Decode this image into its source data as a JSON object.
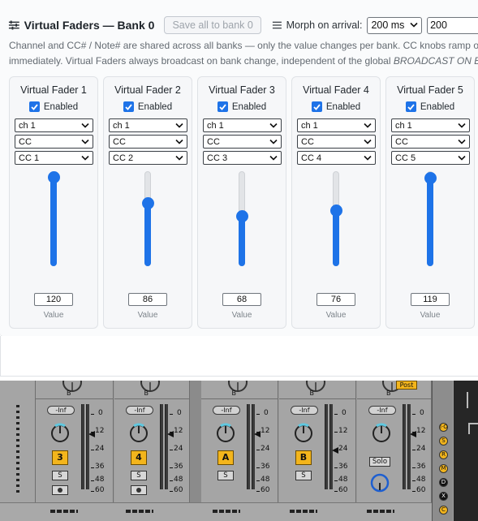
{
  "panel": {
    "title": "Virtual Faders — Bank 0",
    "save_button": "Save all to bank 0",
    "morph_label": "Morph on arrival:",
    "morph_select_value": "200 ms",
    "morph_input_value": "200",
    "description_line1": "Channel and CC# / Note# are shared across all banks — only the value changes per bank. CC knobs ramp ove",
    "description_line2_plain": "immediately. Virtual Faders always broadcast on bank change, independent of the global ",
    "description_line2_italic": "BROADCAST ON BA"
  },
  "faders": [
    {
      "title": "Virtual Fader 1",
      "enabled_label": "Enabled",
      "channel": "ch 1",
      "type": "CC",
      "cc": "CC 1",
      "value": "120",
      "value_label": "Value",
      "level": 120
    },
    {
      "title": "Virtual Fader 2",
      "enabled_label": "Enabled",
      "channel": "ch 1",
      "type": "CC",
      "cc": "CC 2",
      "value": "86",
      "value_label": "Value",
      "level": 86
    },
    {
      "title": "Virtual Fader 3",
      "enabled_label": "Enabled",
      "channel": "ch 1",
      "type": "CC",
      "cc": "CC 3",
      "value": "68",
      "value_label": "Value",
      "level": 68
    },
    {
      "title": "Virtual Fader 4",
      "enabled_label": "Enabled",
      "channel": "ch 1",
      "type": "CC",
      "cc": "CC 4",
      "value": "76",
      "value_label": "Value",
      "level": 76
    },
    {
      "title": "Virtual Fader 5",
      "enabled_label": "Enabled",
      "channel": "ch 1",
      "type": "CC",
      "cc": "CC 5",
      "value": "119",
      "value_label": "Value",
      "level": 119
    }
  ],
  "slider_max": 127,
  "colors": {
    "accent": "#1e73e8",
    "daw_badge": "#f3b51c"
  },
  "daw": {
    "volume_label": "-Inf",
    "post_label": "Post",
    "solo_label": "Solo",
    "s_label": "S",
    "scale": [
      "0",
      "12",
      "24",
      "36",
      "48",
      "60"
    ],
    "strips": [
      {
        "badge": "3"
      },
      {
        "badge": "4"
      },
      {
        "badge": "A"
      },
      {
        "badge": "B"
      }
    ],
    "side_buttons": [
      "I·O",
      "S",
      "R",
      "M",
      "D",
      "X",
      "C"
    ]
  }
}
